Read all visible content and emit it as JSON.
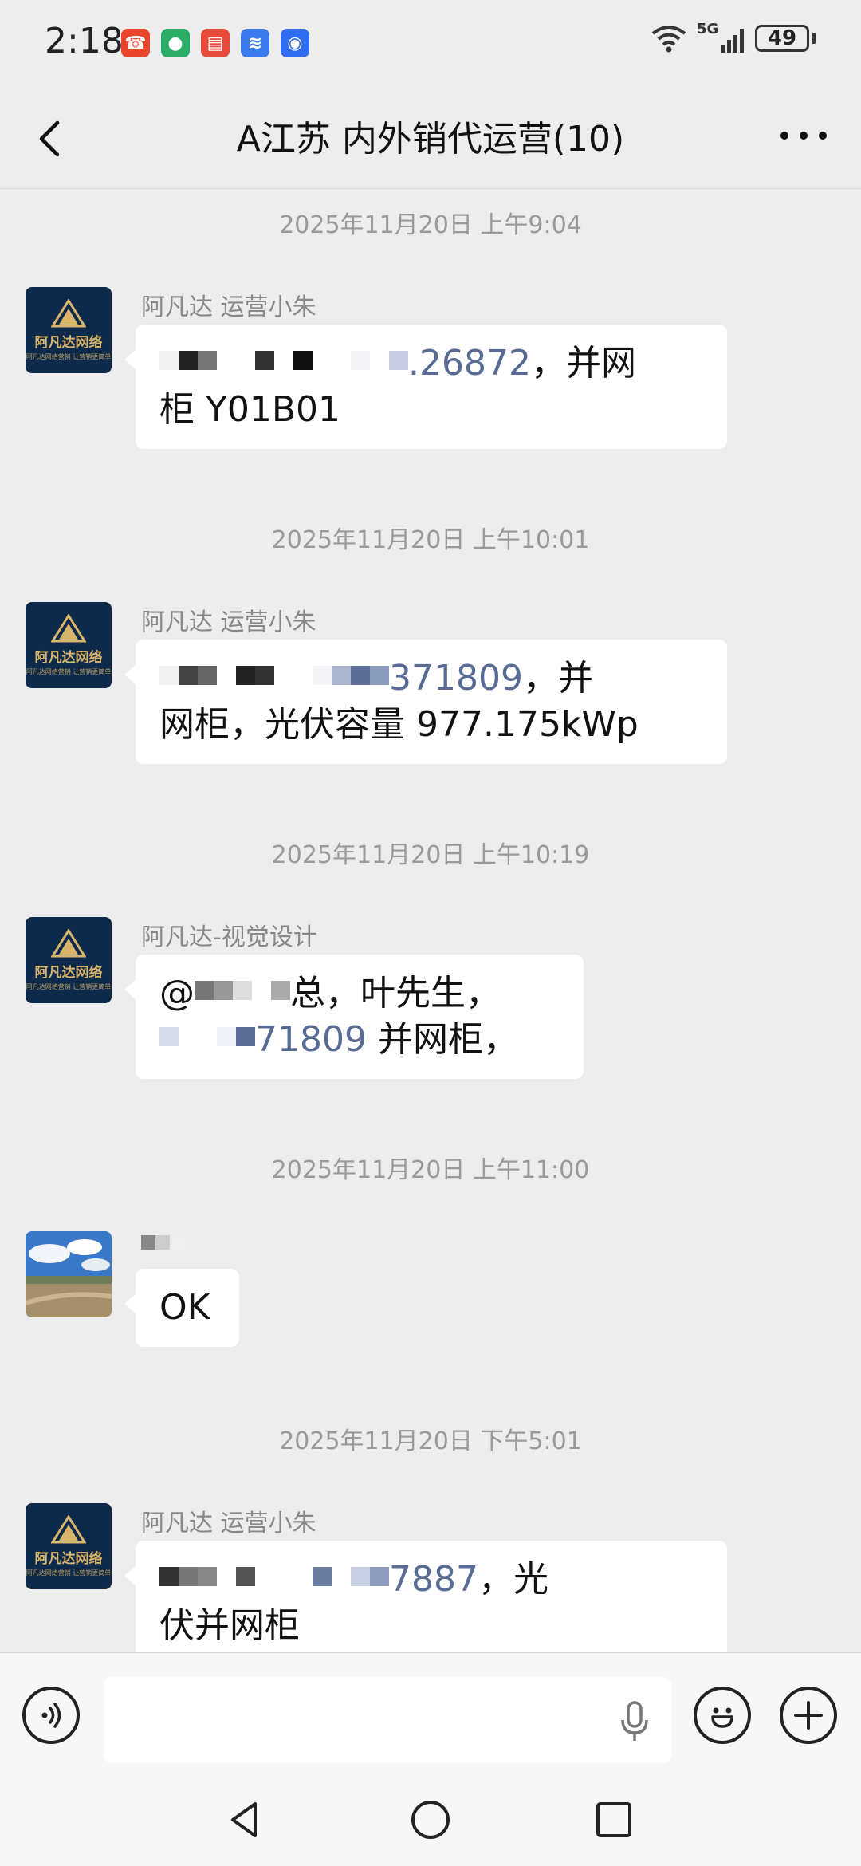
{
  "status_bar": {
    "time": "2:18",
    "battery": "49",
    "network": "5G",
    "icons": [
      "missed-call-icon",
      "wechat-icon",
      "book-app-icon",
      "voice-app-icon",
      "lightbulb-app-icon"
    ]
  },
  "header": {
    "title": "A江苏  内外销代运营(10)"
  },
  "messages": [
    {
      "timestamp": "2025年11月20日 上午9:04",
      "sender": "阿凡达 运营小朱",
      "line1_tail": ".26872",
      "line1_end": "，并网",
      "line2": "柜 Y01B01"
    },
    {
      "timestamp": "2025年11月20日 上午10:01",
      "sender": "阿凡达 运营小朱",
      "line1_tail": "371809",
      "line1_end": "，并",
      "line2": "网柜，光伏容量 977.175kWp"
    },
    {
      "timestamp": "2025年11月20日 上午10:19",
      "sender": "阿凡达-视觉设计",
      "line1_tail": "总，叶先生，",
      "line2_tail": "71809",
      "line2_end": " 并网柜，"
    },
    {
      "timestamp": "2025年11月20日 上午11:00",
      "sender": "",
      "body": "OK"
    },
    {
      "timestamp": "2025年11月20日 下午5:01",
      "sender": "阿凡达 运营小朱",
      "line1_tail": "7887",
      "line1_end": "，光",
      "line2": "伏并网柜"
    }
  ],
  "avatar": {
    "brand_name": "阿凡达网络",
    "brand_slogan": "阿凡达网络营销 让营销更简单"
  },
  "colors": {
    "background": "#ededed",
    "bubble": "#ffffff",
    "mention": "#576b95",
    "brand_navy": "#0e2a4a",
    "brand_gold": "#d9b46b"
  }
}
